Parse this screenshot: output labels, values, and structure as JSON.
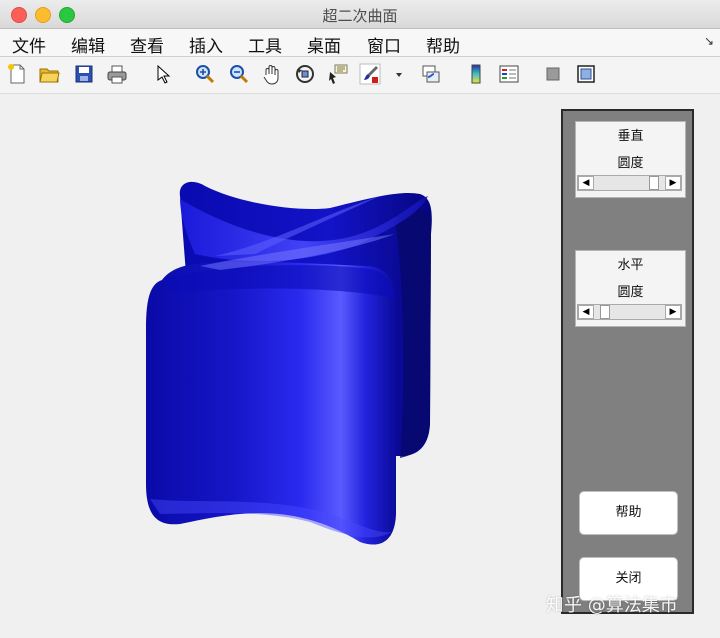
{
  "window": {
    "title": "超二次曲面"
  },
  "menu": {
    "items": [
      "文件",
      "编辑",
      "查看",
      "插入",
      "工具",
      "桌面",
      "窗口",
      "帮助"
    ],
    "corner_icon": "dock-arrow-icon"
  },
  "toolbar": {
    "icons": [
      "new-figure-icon",
      "open-file-icon",
      "save-icon",
      "print-icon",
      "select-arrow-icon",
      "zoom-in-icon",
      "zoom-out-icon",
      "pan-hand-icon",
      "rotate-3d-icon",
      "data-cursor-icon",
      "brush-icon",
      "link-plot-icon",
      "colorbar-icon",
      "legend-icon",
      "hide-plot-tools-icon",
      "show-plot-tools-icon"
    ]
  },
  "figure": {
    "surface_color": "#1010d0",
    "description_label": ""
  },
  "controls": {
    "vertical": {
      "line1": "垂直",
      "line2": "圆度",
      "value": 0.9
    },
    "horizontal": {
      "line1": "水平",
      "line2": "圆度",
      "value": 0.1
    },
    "help_label": "帮助",
    "close_label": "关闭",
    "panel_color": "#808080"
  },
  "watermark": {
    "text": "知乎 @算法集市"
  }
}
